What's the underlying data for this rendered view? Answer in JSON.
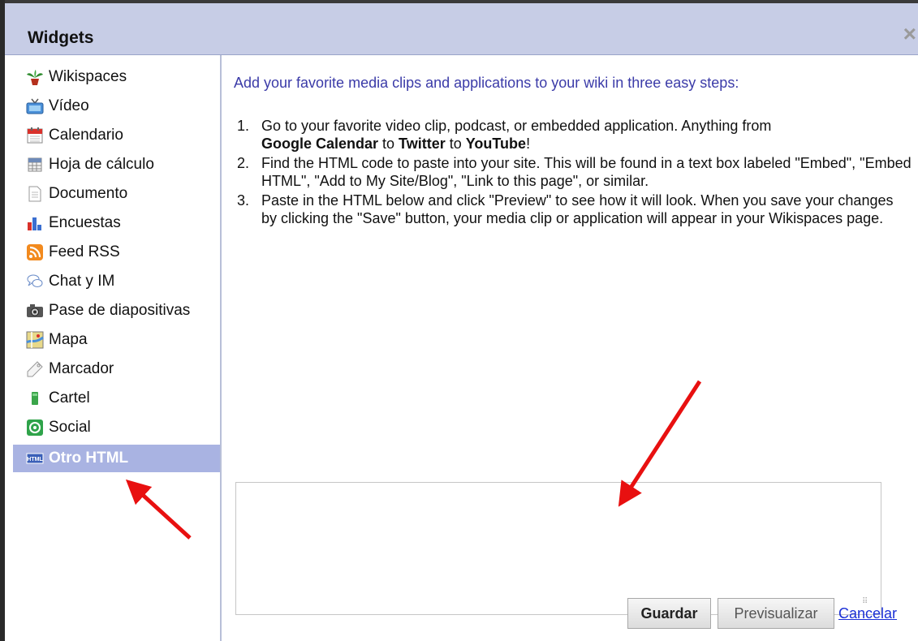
{
  "dialog": {
    "title": "Widgets",
    "close_glyph": "×"
  },
  "sidebar": {
    "items": [
      {
        "label": "Wikispaces",
        "icon": "wikispaces-plant-icon"
      },
      {
        "label": "Vídeo",
        "icon": "video-tv-icon"
      },
      {
        "label": "Calendario",
        "icon": "calendar-icon"
      },
      {
        "label": "Hoja de cálculo",
        "icon": "spreadsheet-icon"
      },
      {
        "label": "Documento",
        "icon": "document-icon"
      },
      {
        "label": "Encuestas",
        "icon": "bar-chart-icon"
      },
      {
        "label": "Feed RSS",
        "icon": "rss-icon"
      },
      {
        "label": "Chat y IM",
        "icon": "chat-bubbles-icon"
      },
      {
        "label": "Pase de diapositivas",
        "icon": "camera-icon"
      },
      {
        "label": "Mapa",
        "icon": "map-icon"
      },
      {
        "label": "Marcador",
        "icon": "tag-icon"
      },
      {
        "label": "Cartel",
        "icon": "poster-icon"
      },
      {
        "label": "Social",
        "icon": "social-icon"
      },
      {
        "label": "Otro HTML",
        "icon": "html-icon",
        "active": true
      }
    ]
  },
  "content": {
    "intro": "Add your favorite media clips and applications to your wiki in three easy steps:",
    "steps": [
      {
        "num": "1.",
        "a": "Go to your favorite video clip, podcast, or embedded application. Anything from",
        "b1": "Google Calendar",
        "t1": " to ",
        "b2": "Twitter",
        "t2": " to ",
        "b3": "YouTube",
        "t3": "!"
      },
      {
        "num": "2.",
        "text": "Find the HTML code to paste into your site. This will be found in a text box labeled \"Embed\", \"Embed HTML\", \"Add to My Site/Blog\", \"Link to this page\", or similar."
      },
      {
        "num": "3.",
        "text": "Paste in the HTML below and click \"Preview\" to see how it will look. When you save your changes by clicking the \"Save\" button, your media clip or application will appear in your Wikispaces page."
      }
    ],
    "textarea_value": ""
  },
  "buttons": {
    "save": "Guardar",
    "preview": "Previsualizar",
    "cancel": "Cancelar"
  },
  "colors": {
    "titlebar": "#c7cde6",
    "active_item": "#a9b3e2",
    "intro_text": "#3b3ba8",
    "arrow": "#e81010",
    "link": "#1a2fd6"
  }
}
